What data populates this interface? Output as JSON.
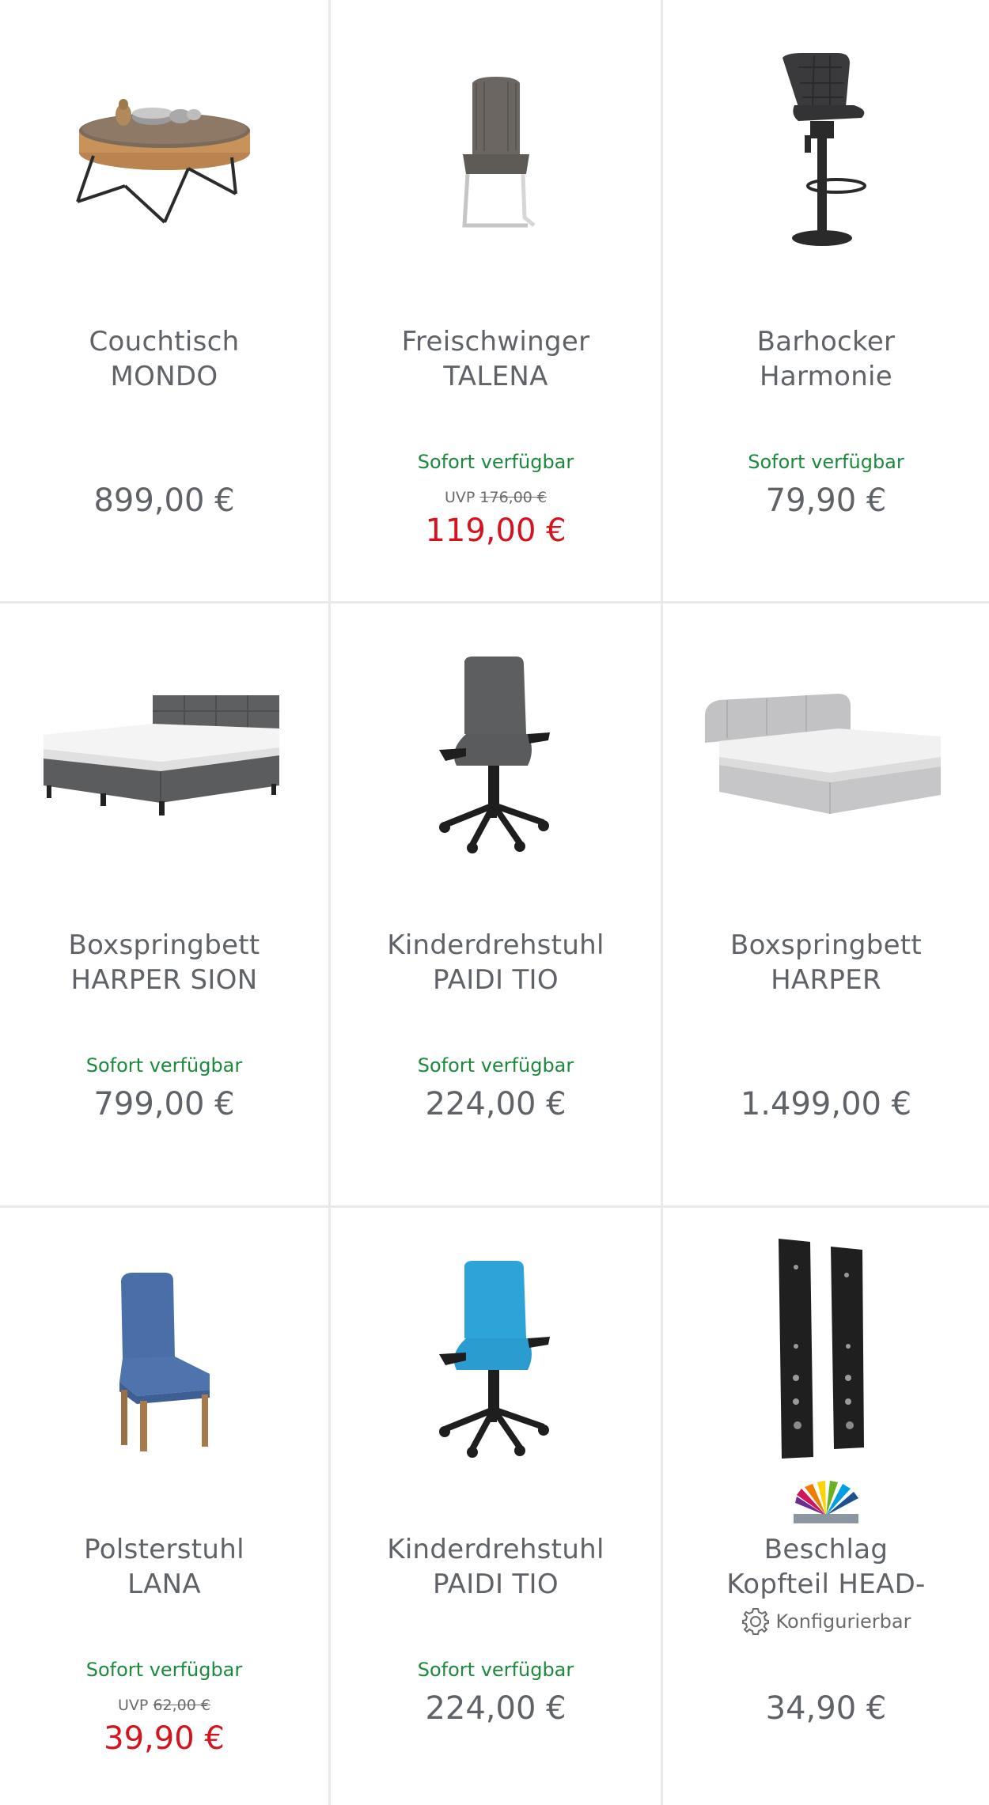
{
  "products": [
    {
      "name_line1": "Couchtisch",
      "name_line2": "MONDO",
      "availability": "",
      "uvp_label": "",
      "uvp_price": "",
      "price": "899,00 €",
      "image_icon": "round-coffee-table-icon"
    },
    {
      "name_line1": "Freischwinger",
      "name_line2": "TALENA",
      "availability": "Sofort verfügbar",
      "uvp_label": "UVP",
      "uvp_price": "176,00 €",
      "price": "119,00 €",
      "image_icon": "cantilever-chair-icon"
    },
    {
      "name_line1": "Barhocker",
      "name_line2": "Harmonie",
      "availability": "Sofort verfügbar",
      "uvp_label": "",
      "uvp_price": "",
      "price": "79,90 €",
      "image_icon": "bar-stool-icon"
    },
    {
      "name_line1": "Boxspringbett",
      "name_line2": "HARPER SION",
      "availability": "Sofort verfügbar",
      "uvp_label": "",
      "uvp_price": "",
      "price": "799,00 €",
      "image_icon": "dark-boxspring-bed-icon"
    },
    {
      "name_line1": "Kinderdrehstuhl",
      "name_line2": "PAIDI TIO",
      "availability": "Sofort verfügbar",
      "uvp_label": "",
      "uvp_price": "",
      "price": "224,00 €",
      "image_icon": "grey-office-chair-icon"
    },
    {
      "name_line1": "Boxspringbett",
      "name_line2": "HARPER",
      "availability": "",
      "uvp_label": "",
      "uvp_price": "",
      "price": "1.499,00 €",
      "image_icon": "light-boxspring-bed-icon"
    },
    {
      "name_line1": "Polsterstuhl",
      "name_line2": "LANA",
      "availability": "Sofort verfügbar",
      "uvp_label": "UVP",
      "uvp_price": "62,00 €",
      "price": "39,90 €",
      "image_icon": "blue-upholstered-chair-icon"
    },
    {
      "name_line1": "Kinderdrehstuhl",
      "name_line2": "PAIDI TIO",
      "availability": "Sofort verfügbar",
      "uvp_label": "",
      "uvp_price": "",
      "price": "224,00 €",
      "image_icon": "blue-office-chair-icon"
    },
    {
      "name_line1": "Beschlag",
      "name_line2": "Kopfteil HEAD-",
      "availability": "",
      "configurable": "Konfigurierbar",
      "uvp_label": "",
      "uvp_price": "",
      "price": "34,90 €",
      "image_icon": "headboard-bracket-icon",
      "brand_icon": "rainbow-fan-logo-icon"
    }
  ],
  "colors": {
    "text": "#5f6368",
    "availability": "#1b8a3c",
    "sale": "#d5121e",
    "divider": "#e7e9ec"
  }
}
